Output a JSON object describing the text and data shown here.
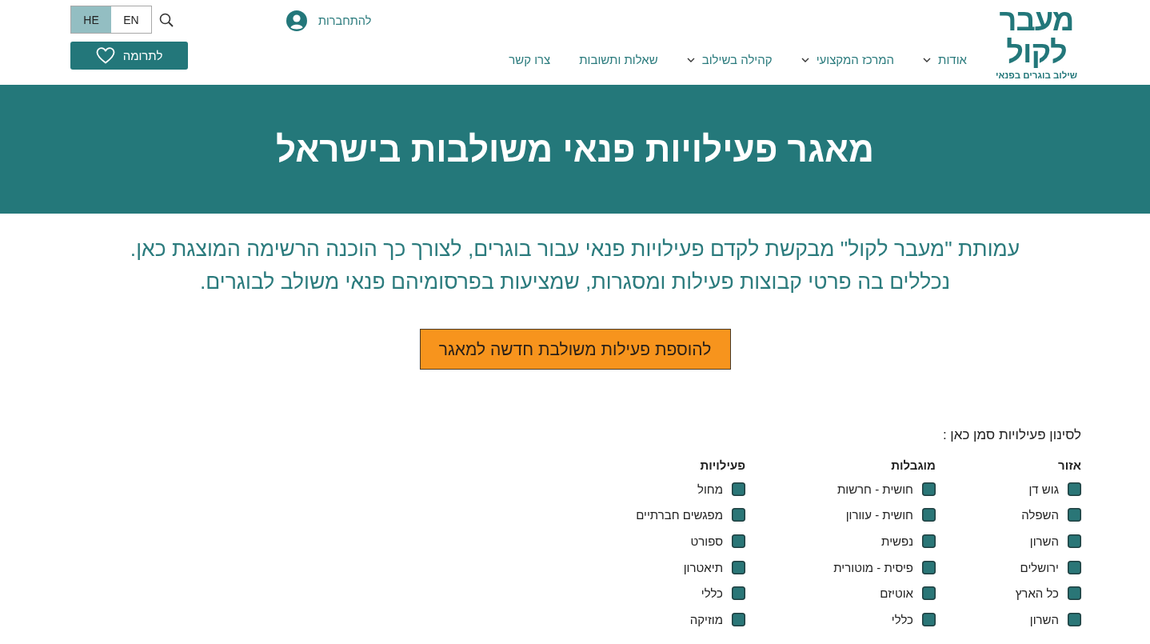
{
  "header": {
    "logo": {
      "name_lines": [
        "מעבר",
        "לקול"
      ],
      "tagline": "שילוב בוגרים בפנאי"
    },
    "nav": [
      {
        "label": "אודות",
        "dropdown": true
      },
      {
        "label": "המרכז המקצועי",
        "dropdown": true
      },
      {
        "label": "קהילה בשילוב",
        "dropdown": true
      },
      {
        "label": "שאלות ותשובות",
        "dropdown": false
      },
      {
        "label": "צרו קשר",
        "dropdown": false
      }
    ],
    "login": {
      "label": "להתחברות"
    },
    "languages": [
      {
        "label": "EN",
        "selected": false
      },
      {
        "label": "HE",
        "selected": true
      }
    ],
    "donate_button": {
      "label": "לתרומה"
    }
  },
  "banner": {
    "title": "מאגר פעילויות פנאי משולבות בישראל"
  },
  "intro": {
    "lines": [
      "עמותת \"מעבר לקול\" מבקשת לקדם פעילויות פנאי עבור בוגרים, לצורך כך הוכנה הרשימה המוצגת כאן.",
      "נכללים בה פרטי קבוצות פעילות ומסגרות, שמציעות בפרסומיהם פנאי משולב לבוגרים."
    ]
  },
  "add_button": {
    "label": "להוספת פעילות משולבת חדשה למאגר"
  },
  "filters": {
    "label": "לסינון פעילויות סמן כאן :",
    "groups": [
      {
        "title": "אזור",
        "options": [
          {
            "label": "גוש דן",
            "checked": false
          },
          {
            "label": "השפלה",
            "checked": false
          },
          {
            "label": "השרון",
            "checked": false
          },
          {
            "label": "ירושלים",
            "checked": false
          },
          {
            "label": "כל הארץ",
            "checked": false
          },
          {
            "label": "השרון",
            "checked": false
          }
        ]
      },
      {
        "title": "מוגבלות",
        "options": [
          {
            "label": "חושית - חרשות",
            "checked": false
          },
          {
            "label": "חושית - עוורון",
            "checked": false
          },
          {
            "label": "נפשית",
            "checked": false
          },
          {
            "label": "פיסית - מוטורית",
            "checked": false
          },
          {
            "label": "אוטיזם",
            "checked": false
          },
          {
            "label": "כללי",
            "checked": false
          }
        ]
      },
      {
        "title": "פעילויות",
        "options": [
          {
            "label": "מחול",
            "checked": false
          },
          {
            "label": "מפגשים חברתיים",
            "checked": false
          },
          {
            "label": "ספורט",
            "checked": false
          },
          {
            "label": "תיאטרון",
            "checked": false
          },
          {
            "label": "כללי",
            "checked": false
          },
          {
            "label": "מוזיקה",
            "checked": false
          }
        ]
      }
    ]
  }
}
